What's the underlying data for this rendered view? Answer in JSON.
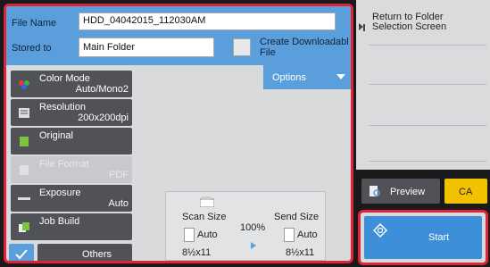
{
  "filename": {
    "label": "File Name",
    "value": "HDD_04042015_112030AM"
  },
  "stored_to": {
    "label": "Stored to",
    "value": "Main Folder"
  },
  "create_download": {
    "label_line1": "Create Downloadabl",
    "label_line2": "File"
  },
  "options": {
    "label": "Options"
  },
  "settings": [
    {
      "title": "Color Mode",
      "value": "Auto/Mono2",
      "icon": "color-mode-icon",
      "enabled": true
    },
    {
      "title": "Resolution",
      "value": "200x200dpi",
      "icon": "resolution-icon",
      "enabled": true
    },
    {
      "title": "Original",
      "value": "",
      "icon": "original-icon",
      "enabled": true
    },
    {
      "title": "File Format",
      "value": "PDF",
      "icon": "file-format-icon",
      "enabled": false
    },
    {
      "title": "Exposure",
      "value": "Auto",
      "icon": "exposure-icon",
      "enabled": true
    },
    {
      "title": "Job Build",
      "value": "",
      "icon": "job-build-icon",
      "enabled": true
    }
  ],
  "others": {
    "label": "Others"
  },
  "scan_info": {
    "scan_size_label": "Scan Size",
    "scan_size_value": "Auto",
    "scan_paper": "8½x11",
    "ratio": "100%",
    "send_size_label": "Send Size",
    "send_size_value": "Auto",
    "send_paper": "8½x11"
  },
  "right_panel": {
    "return_line1": "Return to Folder",
    "return_line2": "Selection Screen"
  },
  "preview": {
    "label": "Preview"
  },
  "ca": {
    "label": "CA"
  },
  "start": {
    "label": "Start"
  }
}
